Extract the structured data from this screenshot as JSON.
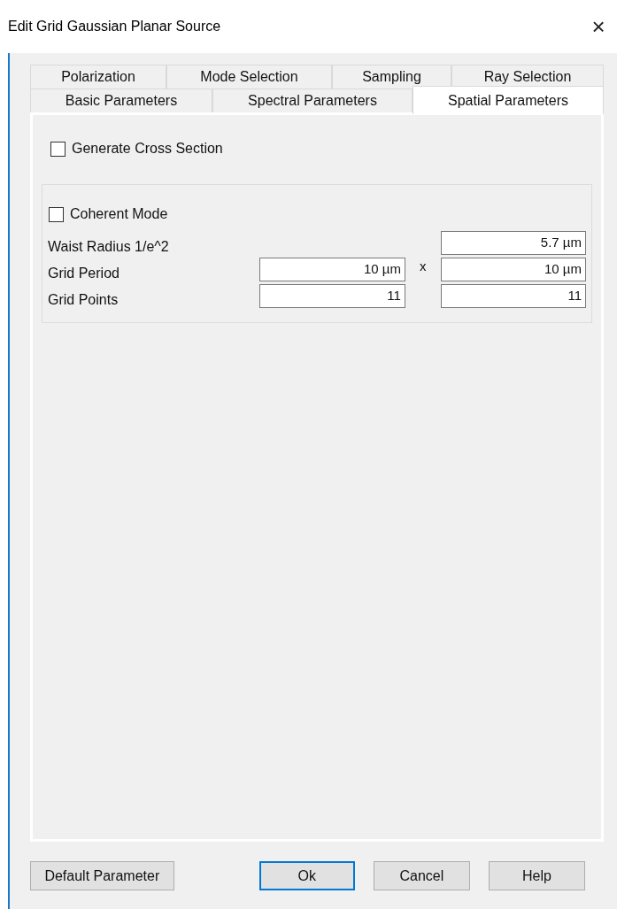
{
  "window": {
    "title": "Edit Grid Gaussian Planar Source",
    "close": "×"
  },
  "tab_rows": [
    [
      {
        "label": "Polarization",
        "selected": false
      },
      {
        "label": "Mode Selection",
        "selected": false
      },
      {
        "label": "Sampling",
        "selected": false
      },
      {
        "label": "Ray Selection",
        "selected": false
      }
    ],
    [
      {
        "label": "Basic Parameters",
        "selected": false
      },
      {
        "label": "Spectral Parameters",
        "selected": false
      },
      {
        "label": "Spatial Parameters",
        "selected": true
      }
    ]
  ],
  "generate_cross_section": {
    "label": "Generate Cross Section",
    "checked": false
  },
  "group": {
    "coherent_mode": {
      "label": "Coherent Mode",
      "checked": false
    },
    "rows": [
      {
        "label": "Waist Radius 1/e^2",
        "fields": [
          "5.7 µm"
        ]
      },
      {
        "label": "Grid Period",
        "fields": [
          "10 µm",
          "10 µm"
        ],
        "separator": "x"
      },
      {
        "label": "Grid Points",
        "fields": [
          "11",
          "11"
        ]
      }
    ]
  },
  "buttons": [
    {
      "label": "Default Parameter",
      "default": false
    },
    {
      "label": "Ok",
      "default": true
    },
    {
      "label": "Cancel",
      "default": false
    },
    {
      "label": "Help",
      "default": false
    }
  ]
}
